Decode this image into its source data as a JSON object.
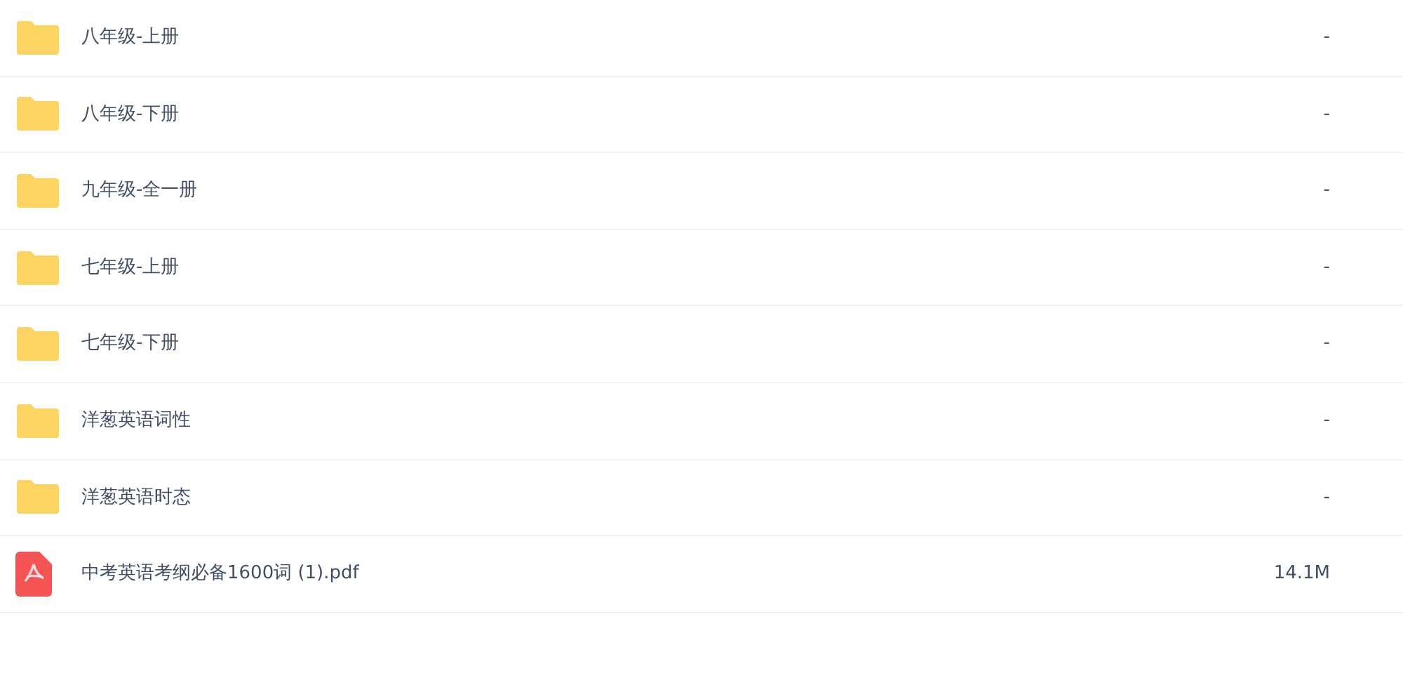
{
  "files": [
    {
      "kind": "folder",
      "name": "八年级-上册",
      "size": "-"
    },
    {
      "kind": "folder",
      "name": "八年级-下册",
      "size": "-"
    },
    {
      "kind": "folder",
      "name": "九年级-全一册",
      "size": "-"
    },
    {
      "kind": "folder",
      "name": "七年级-上册",
      "size": "-"
    },
    {
      "kind": "folder",
      "name": "七年级-下册",
      "size": "-"
    },
    {
      "kind": "folder",
      "name": "洋葱英语词性",
      "size": "-"
    },
    {
      "kind": "folder",
      "name": "洋葱英语时态",
      "size": "-"
    },
    {
      "kind": "pdf",
      "name": "中考英语考纲必备1600词 (1).pdf",
      "size": "14.1M"
    }
  ]
}
